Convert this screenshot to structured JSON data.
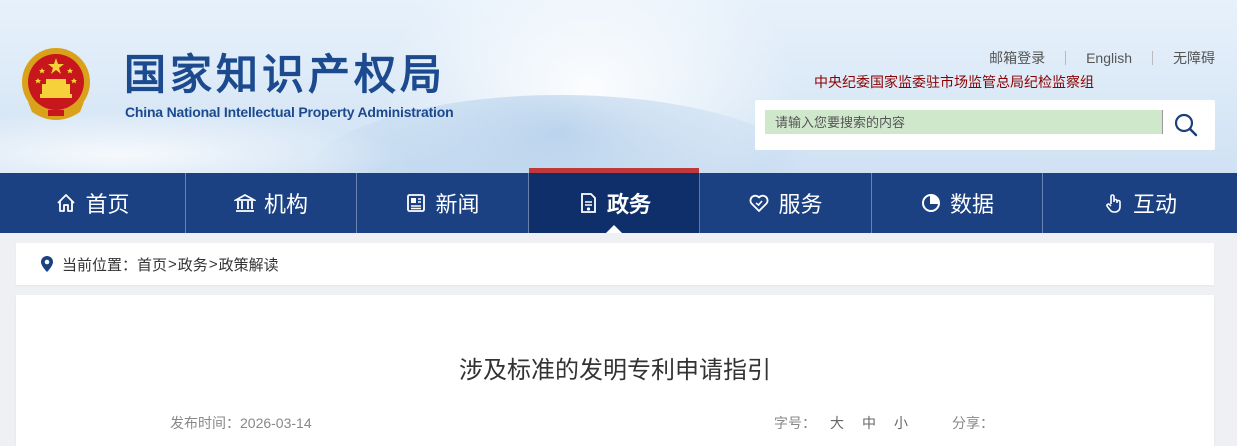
{
  "header": {
    "logo_cn": "国家知识产权局",
    "logo_en": "China National Intellectual Property Administration",
    "links": [
      "邮箱登录",
      "English",
      "无障碍"
    ],
    "discipline": "中央纪委国家监委驻市场监管总局纪检监察组",
    "search": {
      "placeholder": "请输入您要搜索的内容"
    }
  },
  "nav": [
    {
      "label": "首页",
      "icon": "home-icon"
    },
    {
      "label": "机构",
      "icon": "institution-icon"
    },
    {
      "label": "新闻",
      "icon": "news-icon"
    },
    {
      "label": "政务",
      "icon": "document-icon",
      "active": true
    },
    {
      "label": "服务",
      "icon": "heart-service-icon"
    },
    {
      "label": "数据",
      "icon": "pie-chart-icon"
    },
    {
      "label": "互动",
      "icon": "hand-touch-icon"
    }
  ],
  "breadcrumb": {
    "prefix": "当前位置：",
    "items": [
      "首页",
      "政务",
      "政策解读"
    ]
  },
  "article": {
    "title": "涉及标准的发明专利申请指引",
    "publish_label": "发布时间：",
    "publish_date": "2026-03-14",
    "font_label": "字号：",
    "sizes": [
      "大",
      "中",
      "小"
    ],
    "share_label": "分享："
  },
  "colors": {
    "nav_bg": "#1b4183",
    "nav_active_bg": "#0f2f6a",
    "nav_active_top": "#c0393a",
    "logo_blue": "#1b4a8e",
    "discipline_red": "#8b0000",
    "search_input_bg": "#cfe8cc"
  }
}
